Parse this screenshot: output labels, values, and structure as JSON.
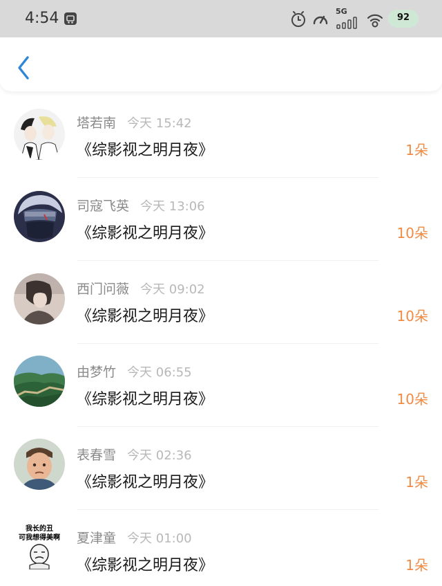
{
  "status_bar": {
    "time": "4:54",
    "network_label": "5G",
    "battery": "92",
    "icons": [
      "app-notification-icon",
      "alarm-icon",
      "speed-icon",
      "signal-icon",
      "wifi-icon",
      "battery-icon"
    ]
  },
  "header": {
    "back_icon": "chevron-left-icon"
  },
  "colors": {
    "accent": "#f08a44",
    "back": "#2f86d6",
    "name": "#8a8a8a",
    "time": "#b8b8b8"
  },
  "items": [
    {
      "name": "塔若南",
      "time": "今天 15:42",
      "title": "《综影视之明月夜》",
      "amount": "1朵"
    },
    {
      "name": "司寇飞英",
      "time": "今天 13:06",
      "title": "《综影视之明月夜》",
      "amount": "10朵"
    },
    {
      "name": "西门问薇",
      "time": "今天 09:02",
      "title": "《综影视之明月夜》",
      "amount": "10朵"
    },
    {
      "name": "由梦竹",
      "time": "今天 06:55",
      "title": "《综影视之明月夜》",
      "amount": "10朵"
    },
    {
      "name": "表春雪",
      "time": "今天 02:36",
      "title": "《综影视之明月夜》",
      "amount": "1朵"
    },
    {
      "name": "夏津童",
      "time": "今天 01:00",
      "title": "《综影视之明月夜》",
      "amount": "1朵",
      "avatar_caption": [
        "我长的丑",
        "可我想得美啊"
      ]
    }
  ]
}
